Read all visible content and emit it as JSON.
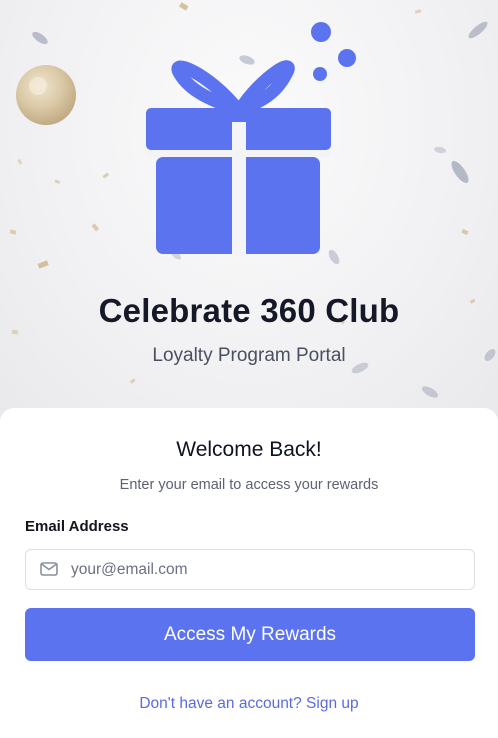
{
  "brand": {
    "title": "Celebrate 360 Club",
    "subtitle": "Loyalty Program Portal",
    "accent_color": "#5b73ef",
    "logo_icon": "gift-icon"
  },
  "login": {
    "heading": "Welcome Back!",
    "subheading": "Enter your email to access your rewards",
    "email_label": "Email Address",
    "email_placeholder": "your@email.com",
    "email_value": "",
    "email_icon": "mail-icon",
    "submit_label": "Access My Rewards",
    "signup_link": "Don't have an account? Sign up"
  }
}
